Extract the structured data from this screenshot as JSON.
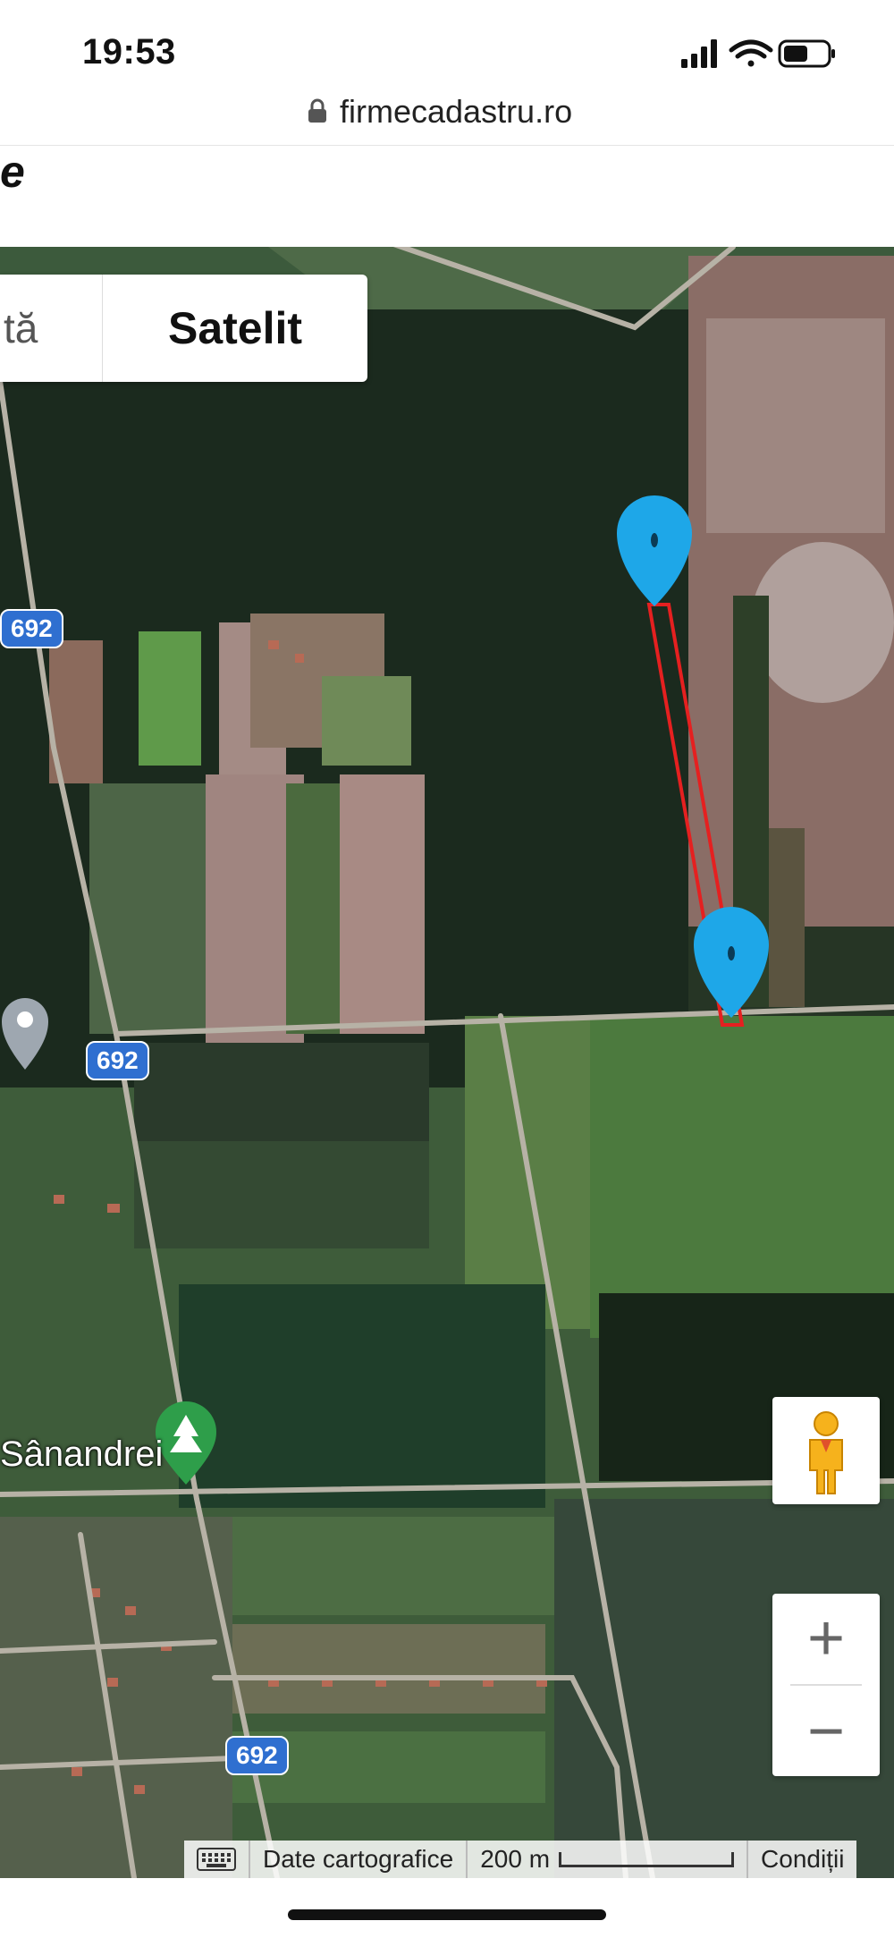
{
  "status_bar": {
    "time": "19:53",
    "icons": [
      "signal-icon",
      "wifi-icon",
      "battery-icon"
    ]
  },
  "browser": {
    "url": "firmecadastru.ro",
    "lock_icon": "lock-icon"
  },
  "page": {
    "header_fragment": "e"
  },
  "map": {
    "map_type_left": "tă",
    "map_type_selected": "Satelit",
    "road_badges": [
      "692",
      "692",
      "692"
    ],
    "place_label": "Sânandrei",
    "zoom_in": "+",
    "zoom_out": "−",
    "attribution": {
      "map_data": "Date cartografice",
      "scale": "200 m",
      "terms": "Condiții"
    },
    "colors": {
      "marker": "#1ea7e8",
      "parcel_outline": "#e52020",
      "road_badge": "#2f6fd0"
    }
  }
}
